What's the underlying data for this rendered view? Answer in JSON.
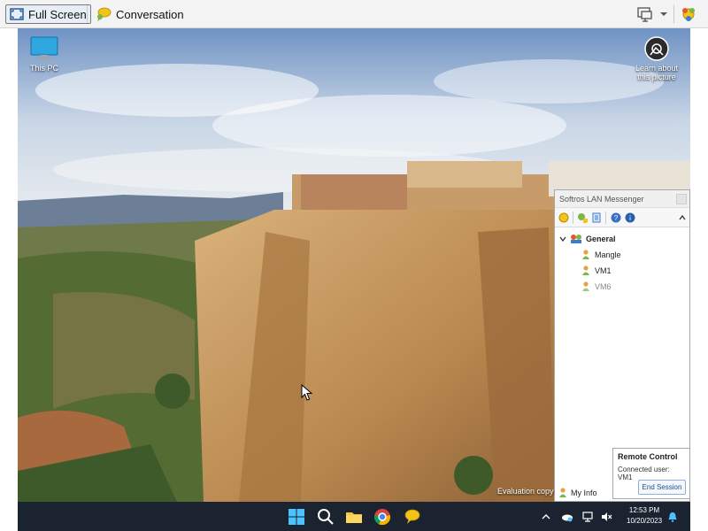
{
  "toolbar": {
    "full_screen_label": "Full Screen",
    "conversation_label": "Conversation"
  },
  "desktop": {
    "this_pc_label": "This PC",
    "learn_line1": "Learn about",
    "learn_line2": "this picture",
    "evaluation_text": "Evaluation copy"
  },
  "messenger": {
    "title": "Softros LAN Messenger",
    "group_name": "General",
    "users": [
      {
        "name": "Mangle",
        "online": true
      },
      {
        "name": "VM1",
        "online": true
      },
      {
        "name": "VM6",
        "online": false
      }
    ],
    "my_info_label": "My Info"
  },
  "remote_control": {
    "title": "Remote Control",
    "connected_user": "Connected user: VM1",
    "end_session_label": "End Session"
  },
  "taskbar": {
    "time": "12:53 PM",
    "date": "10/20/2023"
  },
  "colors": {
    "taskbar_bg": "#1b2230",
    "sky_blue": "#6f93c4",
    "cliff": "#c49a62",
    "accent_blue": "#1a4d8c"
  }
}
